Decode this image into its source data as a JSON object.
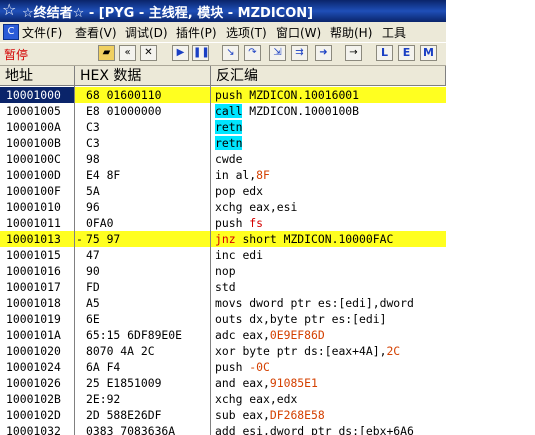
{
  "title": {
    "icon": "☆",
    "text": "☆终结者☆ - [PYG - 主线程, 模块 - MZDICON]"
  },
  "menu": {
    "items": [
      "文件(F)",
      "查看(V)",
      "调试(D)",
      "插件(P)",
      "选项(T)",
      "窗口(W)",
      "帮助(H)",
      "工具"
    ]
  },
  "toolbar": {
    "status": "暂停",
    "buttons": [
      "open-icon",
      "rewind-icon",
      "close-icon",
      "run-icon",
      "pause-icon",
      "step-into-icon",
      "step-over-icon",
      "trace-into-icon",
      "trace-over-icon",
      "execute-till-return-icon",
      "goto-icon"
    ],
    "letters": [
      "L",
      "E",
      "M"
    ]
  },
  "columns": {
    "address": "地址",
    "hex": "HEX 数据",
    "disasm": "反汇编"
  },
  "rows": [
    {
      "addr": "10001000",
      "jmp": "",
      "hex": "68 01600110",
      "mn": "push",
      "op": "MZDICON.10016001"
    },
    {
      "addr": "10001005",
      "jmp": "",
      "hex": "E8 01000000",
      "mn": "call",
      "op": "MZDICON.1000100B"
    },
    {
      "addr": "1000100A",
      "jmp": "",
      "hex": "C3",
      "mn": "retn",
      "op": ""
    },
    {
      "addr": "1000100B",
      "jmp": "",
      "hex": "C3",
      "mn": "retn",
      "op": ""
    },
    {
      "addr": "1000100C",
      "jmp": "",
      "hex": "98",
      "mn": "cwde",
      "op": ""
    },
    {
      "addr": "1000100D",
      "jmp": "",
      "hex": "E4 8F",
      "mn": "in",
      "op": "al,",
      "op2": "8F"
    },
    {
      "addr": "1000100F",
      "jmp": "",
      "hex": "5A",
      "mn": "pop",
      "op": "edx"
    },
    {
      "addr": "10001010",
      "jmp": "",
      "hex": "96",
      "mn": "xchg",
      "op": "eax,esi"
    },
    {
      "addr": "10001011",
      "jmp": "",
      "hex": "0FA0",
      "mn": "push",
      "op": "fs"
    },
    {
      "addr": "10001013",
      "jmp": "-",
      "hex": "75 97",
      "mn": "jnz",
      "op": "short MZDICON.10000FAC"
    },
    {
      "addr": "10001015",
      "jmp": "",
      "hex": "47",
      "mn": "inc",
      "op": "edi"
    },
    {
      "addr": "10001016",
      "jmp": "",
      "hex": "90",
      "mn": "nop",
      "op": ""
    },
    {
      "addr": "10001017",
      "jmp": "",
      "hex": "FD",
      "mn": "std",
      "op": ""
    },
    {
      "addr": "10001018",
      "jmp": "",
      "hex": "A5",
      "mn": "movs",
      "op": "dword ptr es:[edi],dword"
    },
    {
      "addr": "10001019",
      "jmp": "",
      "hex": "6E",
      "mn": "outs",
      "op": "dx,byte ptr es:[edi]"
    },
    {
      "addr": "1000101A",
      "jmp": "",
      "hex": "65:15 6DF89E0E",
      "mn": "adc",
      "op": "eax,",
      "op2": "0E9EF86D"
    },
    {
      "addr": "10001020",
      "jmp": "",
      "hex": "8070 4A 2C",
      "mn": "xor",
      "op": "byte ptr ds:[eax+4A],",
      "op2": "2C"
    },
    {
      "addr": "10001024",
      "jmp": "",
      "hex": "6A F4",
      "mn": "push",
      "op": "",
      "op2": "-0C"
    },
    {
      "addr": "10001026",
      "jmp": "",
      "hex": "25 E1851009",
      "mn": "and",
      "op": "eax,",
      "op2": "91085E1"
    },
    {
      "addr": "1000102B",
      "jmp": "",
      "hex": "2E:92",
      "mn": "xchg",
      "op": "eax,edx"
    },
    {
      "addr": "1000102D",
      "jmp": "",
      "hex": "2D 588E26DF",
      "mn": "sub",
      "op": "eax,",
      "op2": "DF268E58"
    },
    {
      "addr": "10001032",
      "jmp": "",
      "hex": "0383 7083636A",
      "mn": "add",
      "op": "esi,dword ptr ds:[ebx+6A6"
    }
  ],
  "colors": {
    "selection": "#0a246a",
    "highlight": "#ffff20",
    "call_highlight": "#00e5ff",
    "constant": "#d44000"
  }
}
